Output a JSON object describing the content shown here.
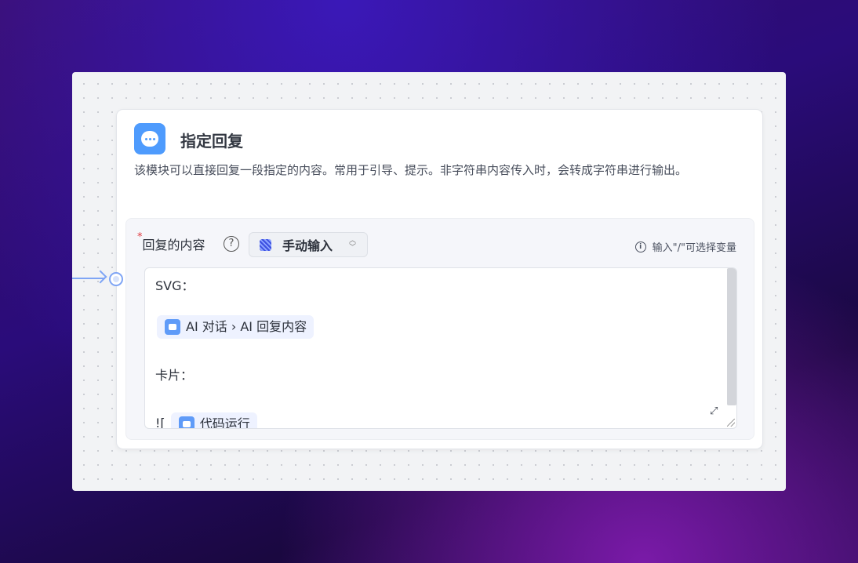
{
  "node": {
    "icon": "chat-bubble-icon",
    "title": "指定回复",
    "description": "该模块可以直接回复一段指定的内容。常用于引导、提示。非字符串内容传入时，会转成字符串进行输出。",
    "field": {
      "required_mark": "*",
      "label": "回复的内容",
      "help": "?",
      "input_mode": "手动输入",
      "hint": "输入\"/\"可选择变量",
      "content": {
        "line1": "SVG：",
        "chip1": "AI 对话 › AI 回复内容",
        "line2": "卡片：",
        "line3_prefix": "![",
        "chip2": "代码运行"
      }
    }
  },
  "colors": {
    "accent": "#4e9bfd",
    "wire": "#7fa5f5"
  }
}
